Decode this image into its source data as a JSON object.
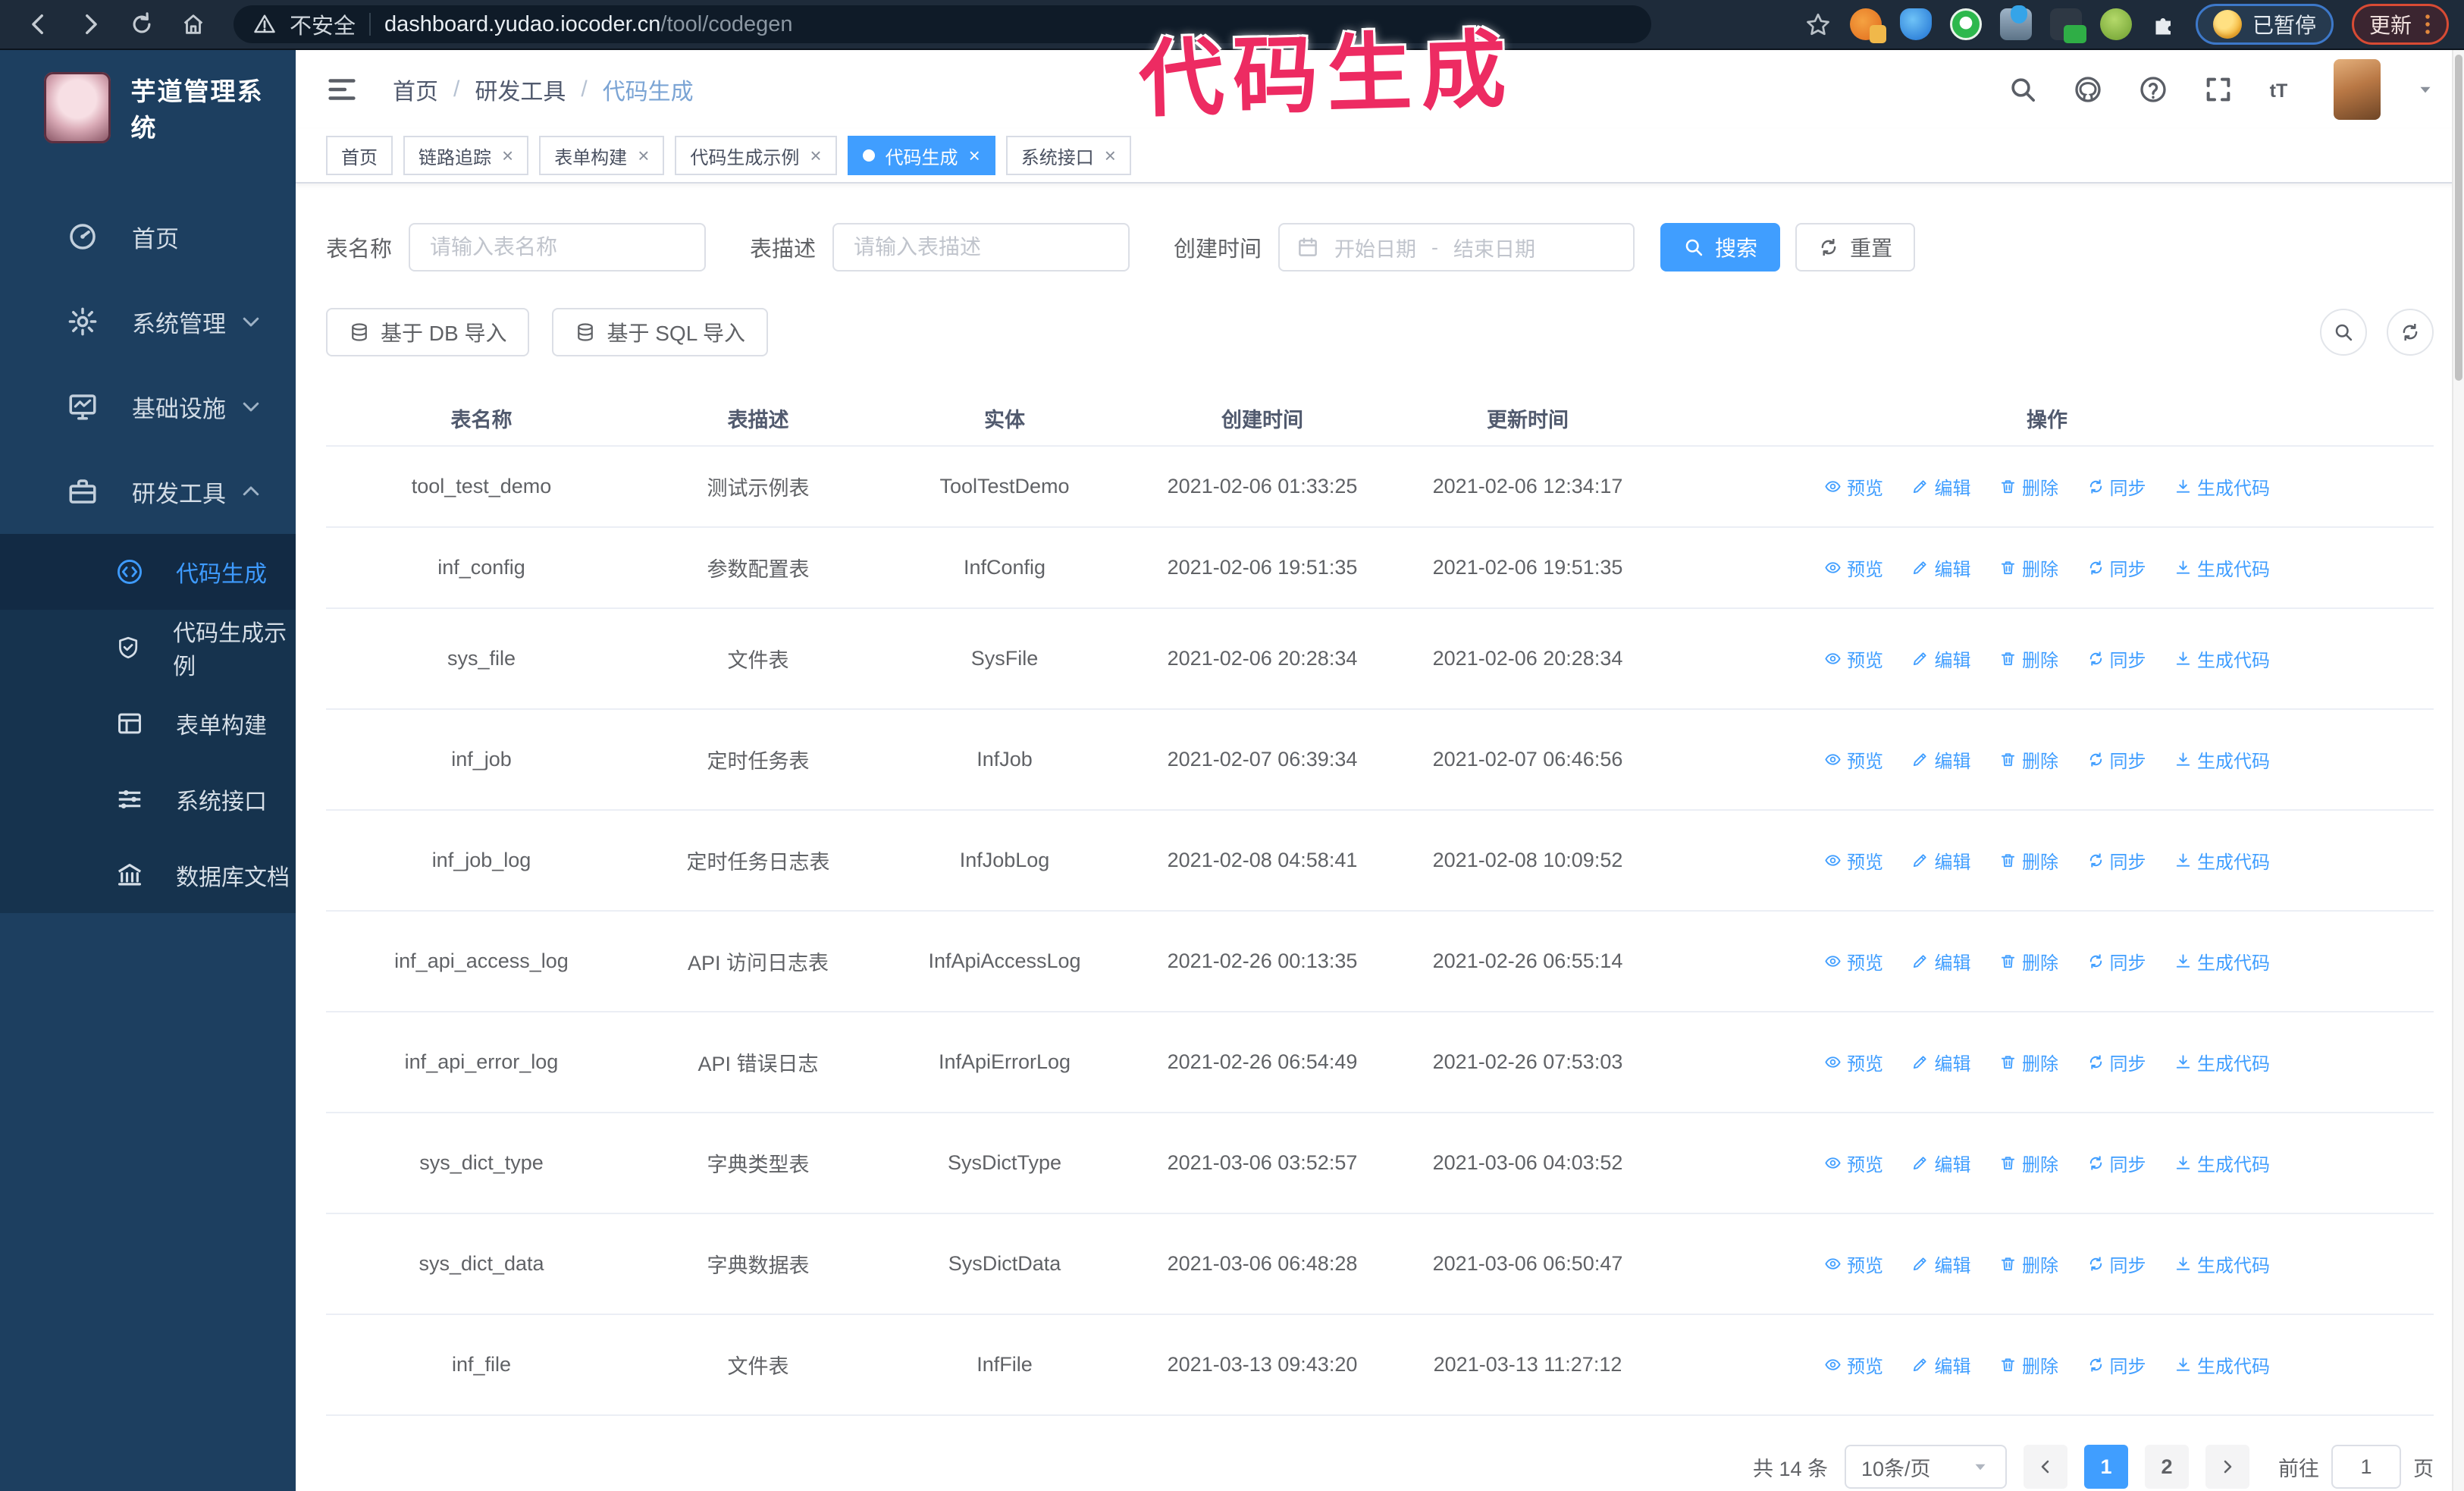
{
  "browser": {
    "not_secure_label": "不安全",
    "url_host": "dashboard.yudao.iocoder.cn",
    "url_path": "/tool/codegen",
    "paused_badge": "已暂停",
    "update_button": "更新"
  },
  "watermark": "代码生成",
  "sidebar": {
    "title": "芋道管理系统",
    "items": [
      {
        "label": "首页"
      },
      {
        "label": "系统管理"
      },
      {
        "label": "基础设施"
      },
      {
        "label": "研发工具"
      }
    ],
    "subitems": [
      {
        "label": "代码生成",
        "active": true
      },
      {
        "label": "代码生成示例",
        "active": false
      },
      {
        "label": "表单构建",
        "active": false
      },
      {
        "label": "系统接口",
        "active": false
      },
      {
        "label": "数据库文档",
        "active": false
      }
    ]
  },
  "header": {
    "breadcrumb": [
      "首页",
      "研发工具",
      "代码生成"
    ],
    "breadcrumb_sep": "/"
  },
  "tabs_close_glyph": "×",
  "tabs": [
    {
      "label": "首页",
      "closable": false,
      "active": false
    },
    {
      "label": "链路追踪",
      "closable": true,
      "active": false
    },
    {
      "label": "表单构建",
      "closable": true,
      "active": false
    },
    {
      "label": "代码生成示例",
      "closable": true,
      "active": false
    },
    {
      "label": "代码生成",
      "closable": true,
      "active": true
    },
    {
      "label": "系统接口",
      "closable": true,
      "active": false
    }
  ],
  "filters": {
    "name_label": "表名称",
    "name_placeholder": "请输入表名称",
    "desc_label": "表描述",
    "desc_placeholder": "请输入表描述",
    "time_label": "创建时间",
    "date_start_placeholder": "开始日期",
    "date_sep": "-",
    "date_end_placeholder": "结束日期",
    "search_label": "搜索",
    "reset_label": "重置"
  },
  "toolbar": {
    "db_import_label": "基于 DB 导入",
    "sql_import_label": "基于 SQL 导入"
  },
  "table": {
    "columns": [
      "表名称",
      "表描述",
      "实体",
      "创建时间",
      "更新时间",
      "操作"
    ],
    "actions": [
      "预览",
      "编辑",
      "删除",
      "同步",
      "生成代码"
    ],
    "rows": [
      {
        "name": "tool_test_demo",
        "desc": "测试示例表",
        "entity": "ToolTestDemo",
        "created": "2021-02-06 01:33:25",
        "updated": "2021-02-06 12:34:17",
        "cwrap": false,
        "uwrap": false
      },
      {
        "name": "inf_config",
        "desc": "参数配置表",
        "entity": "InfConfig",
        "created": "2021-02-06 19:51:35",
        "updated": "2021-02-06 19:51:35",
        "cwrap": false,
        "uwrap": false
      },
      {
        "name": "sys_file",
        "desc": "文件表",
        "entity": "SysFile",
        "created": "2021-02-06 20:28:34",
        "updated": "2021-02-06 20:28:34",
        "cwrap": true,
        "uwrap": true
      },
      {
        "name": "inf_job",
        "desc": "定时任务表",
        "entity": "InfJob",
        "created": "2021-02-07 06:39:34",
        "updated": "2021-02-07 06:46:56",
        "cwrap": true,
        "uwrap": true
      },
      {
        "name": "inf_job_log",
        "desc": "定时任务日志表",
        "entity": "InfJobLog",
        "created": "2021-02-08 04:58:41",
        "updated": "2021-02-08 10:09:52",
        "cwrap": true,
        "uwrap": true
      },
      {
        "name": "inf_api_access_log",
        "desc": "API 访问日志表",
        "entity": "InfApiAccessLog",
        "created": "2021-02-26 00:13:35",
        "updated": "2021-02-26 06:55:14",
        "cwrap": false,
        "uwrap": true
      },
      {
        "name": "inf_api_error_log",
        "desc": "API 错误日志",
        "entity": "InfApiErrorLog",
        "created": "2021-02-26 06:54:49",
        "updated": "2021-02-26 07:53:03",
        "cwrap": true,
        "uwrap": true
      },
      {
        "name": "sys_dict_type",
        "desc": "字典类型表",
        "entity": "SysDictType",
        "created": "2021-03-06 03:52:57",
        "updated": "2021-03-06 04:03:52",
        "cwrap": true,
        "uwrap": true
      },
      {
        "name": "sys_dict_data",
        "desc": "字典数据表",
        "entity": "SysDictData",
        "created": "2021-03-06 06:48:28",
        "updated": "2021-03-06 06:50:47",
        "cwrap": true,
        "uwrap": true
      },
      {
        "name": "inf_file",
        "desc": "文件表",
        "entity": "InfFile",
        "created": "2021-03-13 09:43:20",
        "updated": "2021-03-13 11:27:12",
        "cwrap": true,
        "uwrap": false
      }
    ]
  },
  "pagination": {
    "total_text": "共 14 条",
    "page_size": "10条/页",
    "pages": [
      "1",
      "2"
    ],
    "active_page": "1",
    "goto_label": "前往",
    "goto_value": "1",
    "page_word": "页"
  },
  "colors": {
    "primary": "#409EFF",
    "sidebar_bg": "#1d3f60",
    "browser_bg": "#1e2b3a",
    "watermark_pink": "#ed2b62"
  }
}
